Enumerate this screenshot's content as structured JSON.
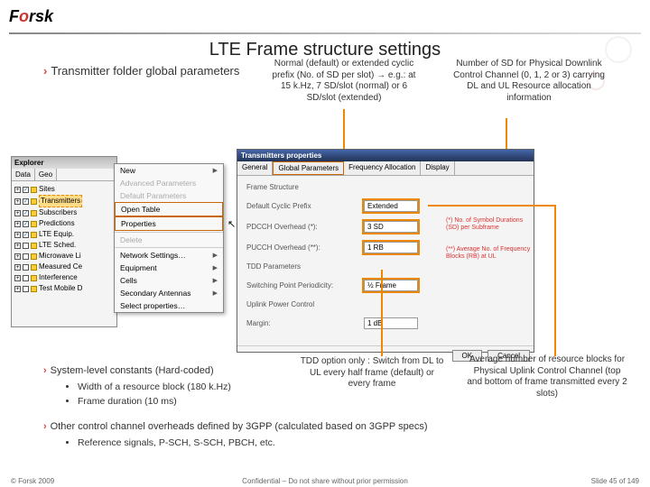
{
  "logo": {
    "pre": "F",
    "accent": "o",
    "post": "rsk"
  },
  "title": "LTE Frame structure settings",
  "subhead": "Transmitter folder global parameters",
  "callouts": {
    "c1": "Normal (default) or extended cyclic prefix (No. of SD per slot) → e.g.: at 15 k.Hz, 7 SD/slot (normal) or 6 SD/slot (extended)",
    "c2": "Number of SD for Physical Downlink Control Channel (0, 1, 2 or 3) carrying DL and UL Resource allocation information",
    "c3": "TDD option only : Switch from DL to UL every half frame (default) or every frame",
    "c4": "Average number of resource blocks for Physical Uplink Control Channel (top and bottom of frame transmitted every 2 slots)"
  },
  "explorer": {
    "title": "Explorer",
    "tabs": [
      "Data",
      "Geo"
    ],
    "items": [
      "Sites",
      "Transmitters",
      "Subscribers",
      "Predictions",
      "LTE Equip.",
      "LTE Sched.",
      "Microwave Li",
      "Measured Ce",
      "Interference",
      "Test Mobile D"
    ],
    "selIndex": 1
  },
  "ctxmenu": {
    "items": [
      {
        "l": "New",
        "arr": true
      },
      {
        "l": "Advanced Parameters",
        "disabled": true
      },
      {
        "l": "Default Parameters",
        "disabled": true
      },
      {
        "l": "Open Table",
        "hl": true
      },
      {
        "l": "Properties",
        "hl": true,
        "sub": true
      },
      {
        "sep": true
      },
      {
        "l": "Delete",
        "disabled": true
      },
      {
        "sep": true
      },
      {
        "l": "Network Settings…",
        "arr": true
      },
      {
        "l": "Equipment",
        "arr": true
      },
      {
        "l": "Cells",
        "arr": true
      },
      {
        "l": "Secondary Antennas",
        "arr": true
      },
      {
        "l": "Select properties…"
      }
    ]
  },
  "dialog": {
    "title": "Transmitters properties",
    "tabs": [
      "General",
      "Global Parameters",
      "Frequency Allocation",
      "Display"
    ],
    "activeTab": 1,
    "fields": {
      "frame": {
        "label": "Frame Structure"
      },
      "cp": {
        "label": "Default Cyclic Prefix",
        "val": "Extended"
      },
      "pdcch": {
        "label": "PDCCH Overhead (*):",
        "val": "3 SD"
      },
      "pucch": {
        "label": "PUCCH Overhead (**):",
        "val": "1 RB"
      },
      "tdd": {
        "label": "TDD Parameters"
      },
      "switch": {
        "label": "Switching Point Periodicity:",
        "val": "½ Frame"
      },
      "upwr": {
        "label": "Uplink Power Control"
      },
      "margin": {
        "label": "Margin:",
        "val": "1 dB"
      }
    },
    "hints": {
      "h1": "(*) No. of Symbol Durations (SD) per Subframe",
      "h2": "(**) Average No. of Frequency Blocks (RB) at UL"
    },
    "buttons": {
      "ok": "OK",
      "cancel": "Cancel"
    }
  },
  "bullets": {
    "sys": {
      "lead": "System-level constants (Hard-coded)",
      "sub": [
        "Width of a resource block (180 k.Hz)",
        "Frame duration (10 ms)"
      ]
    },
    "other": {
      "lead": "Other control channel overheads defined by 3GPP (calculated based on 3GPP specs)",
      "sub": [
        "Reference signals, P-SCH, S-SCH, PBCH, etc."
      ]
    }
  },
  "footer": {
    "left": "© Forsk 2009",
    "mid": "Confidential – Do not share without prior permission",
    "right": "Slide 45 of 149"
  }
}
